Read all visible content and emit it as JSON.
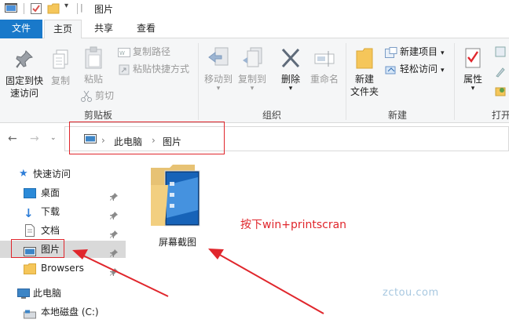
{
  "window": {
    "title": "图片"
  },
  "tabs": {
    "file": "文件",
    "home": "主页",
    "share": "共享",
    "view": "查看"
  },
  "ribbon": {
    "clipboard": {
      "pin_quick_access": "固定到快\n速访问",
      "pin_line1": "固定到快",
      "pin_line2": "速访问",
      "copy": "复制",
      "paste": "粘贴",
      "cut": "剪切",
      "copy_path": "复制路径",
      "paste_shortcut": "粘贴快捷方式",
      "group_label": "剪贴板"
    },
    "organize": {
      "move_to": "移动到",
      "copy_to": "复制到",
      "delete": "删除",
      "rename": "重命名",
      "group_label": "组织"
    },
    "new": {
      "new_folder_line1": "新建",
      "new_folder_line2": "文件夹",
      "new_item": "新建项目",
      "easy_access": "轻松访问",
      "group_label": "新建"
    },
    "open": {
      "properties": "属性",
      "group_label": "打开"
    }
  },
  "address": {
    "crumbs": [
      "此电脑",
      "图片"
    ]
  },
  "sidebar": {
    "items": [
      {
        "label": "快速访问"
      },
      {
        "label": "桌面"
      },
      {
        "label": "下载"
      },
      {
        "label": "文档"
      },
      {
        "label": "图片"
      },
      {
        "label": "Browsers"
      },
      {
        "label": "此电脑"
      },
      {
        "label": "本地磁盘 (C:)"
      }
    ]
  },
  "main": {
    "folder_name": "屏幕截图",
    "annotation": "按下win+printscran",
    "watermark": "zctou.com"
  },
  "colors": {
    "accent": "#1979ca",
    "annotation_red": "#e0262c"
  }
}
